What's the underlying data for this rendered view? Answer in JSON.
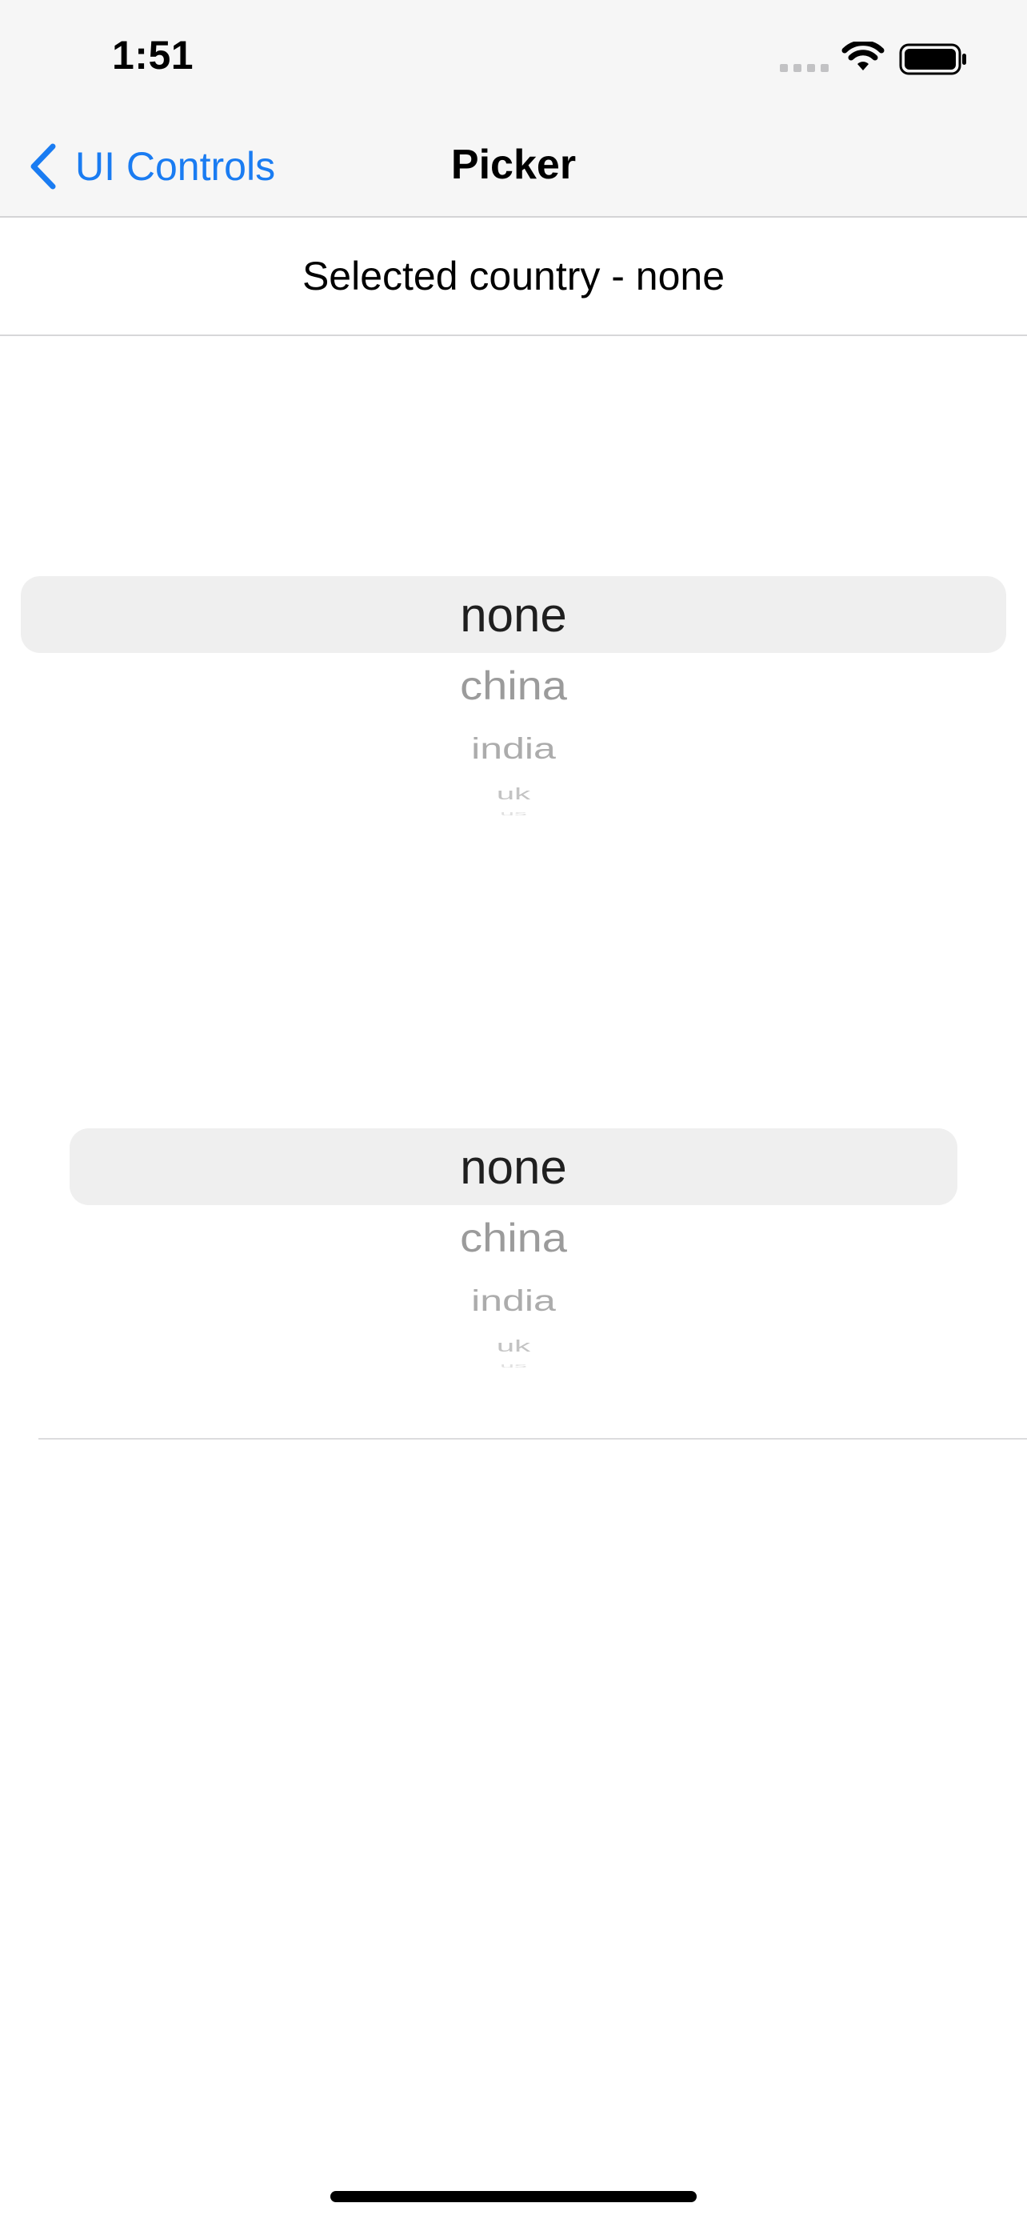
{
  "status_bar": {
    "time": "1:51",
    "icons": [
      "cellular-signal-icon",
      "wifi-icon",
      "battery-icon"
    ]
  },
  "nav_bar": {
    "back_label": "UI Controls",
    "title": "Picker",
    "accent_color": "#1a7cf2"
  },
  "selected_text": "Selected country - none",
  "picker_top": {
    "selected": "none",
    "items": [
      "none",
      "china",
      "india",
      "uk",
      "us"
    ]
  },
  "picker_bottom": {
    "selected": "none",
    "items": [
      "none",
      "china",
      "india",
      "uk",
      "us"
    ]
  }
}
